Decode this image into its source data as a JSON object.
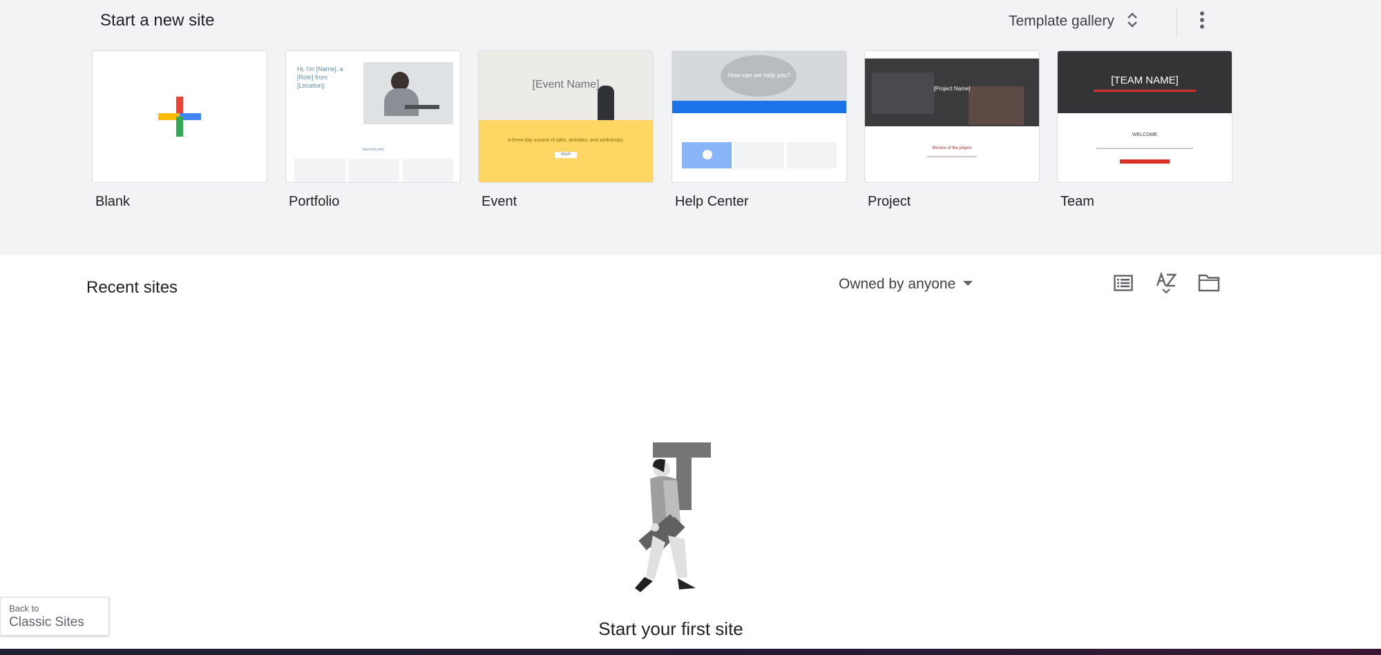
{
  "header": {
    "start_title": "Start a new site",
    "template_gallery_label": "Template gallery"
  },
  "templates": [
    {
      "name": "Blank"
    },
    {
      "name": "Portfolio",
      "preview": {
        "line1": "Hi, I'm [Name], a",
        "line2": "[Role] from",
        "line3": "[Location].",
        "caption": "Selected work"
      }
    },
    {
      "name": "Event",
      "preview": {
        "headline": "[Event Name]",
        "banner": "A three-day summit of talks, activities, and workshops.",
        "button": "RSVP"
      }
    },
    {
      "name": "Help Center",
      "preview": {
        "headline": "How can we help you?"
      }
    },
    {
      "name": "Project",
      "preview": {
        "headline": "[Project Name]",
        "mission": "Mission of the project"
      }
    },
    {
      "name": "Team",
      "preview": {
        "headline": "[TEAM NAME]",
        "welcome": "WELCOME"
      }
    }
  ],
  "recent": {
    "title": "Recent sites",
    "owner_filter": "Owned by anyone"
  },
  "empty_state": {
    "message": "Start your first site"
  },
  "classic": {
    "small": "Back to",
    "big": "Classic Sites"
  },
  "colors": {
    "accent_blue": "#4285f4",
    "red": "#ea4335",
    "yellow": "#fbbc04",
    "green": "#34a853"
  }
}
